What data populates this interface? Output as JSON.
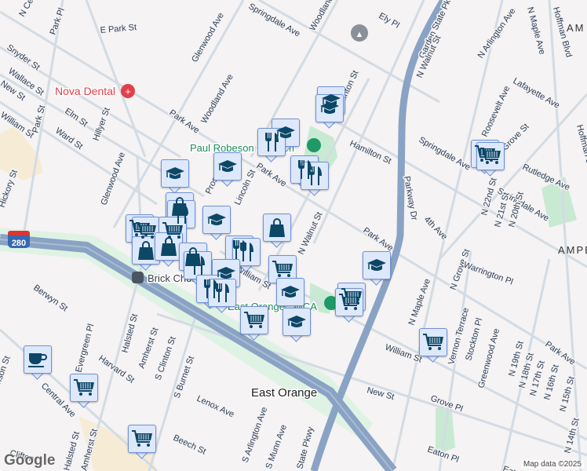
{
  "streets": [
    "N Cen",
    "Park Pl",
    "E Park St",
    "Glenwood Ave",
    "Springdale Ave",
    "Woodland Ave",
    "Ely Pl",
    "Garden State Pk",
    "N Walnut St",
    "N Arlington Ave",
    "N Maple Ave",
    "Hoffman Blvd",
    "Hoffman Blvd",
    "Snyder St",
    "Wallace St",
    "New St",
    "Elm St",
    "Ward St",
    "William St",
    "Park St",
    "Hillyer St",
    "Park Ave",
    "Woodland Ave",
    "Glenwood Ave",
    "Hickory St",
    "Lincoln St",
    "Prospect",
    "Park Ave",
    "N Clinton St",
    "Hamilton St",
    "Springdale Ave",
    "Roosevelt Ave",
    "Lafayette Ave",
    "N Grove St",
    "Rutledge Ave",
    "Springdale Ave",
    "Parkway Dr",
    "4th Ave",
    "N 22nd St",
    "N 21st St",
    "N 20th St",
    "Park Ave",
    "N Grove St",
    "Warrington Pl",
    "N Maple Ave",
    "Vernon Terrace",
    "Stockton Pl",
    "Greenwood Ave",
    "N 19th St",
    "N 18th St",
    "N 17th St",
    "N 16th St",
    "N 15th St",
    "N 14th St",
    "Park Ave",
    "William St",
    "New St",
    "Grove Pl",
    "Eaton Pl",
    "N Walnut St",
    "William St",
    "Berwyn St",
    "Evergreen Pl",
    "Halsted St",
    "Harvard St",
    "Amherst St",
    "S Clinton St",
    "S Burnet St",
    "Lenox Ave",
    "Beech St",
    "Central Ave",
    "S Arlington Ave",
    "S Munn Ave",
    "Halsted St",
    "Amherst St",
    "Clifton",
    "State Pkwy",
    "Eaton",
    "nson St"
  ],
  "places": {
    "nova_dental": "Nova Dental",
    "paul_robeson": "Paul Robeson Stadium",
    "ymca": "East Orange YMCA",
    "brick_church": "Brick Church",
    "east_orange": "East Orange",
    "ampere_top": "AM",
    "ampere": "AMPE"
  },
  "highway_shield": "280",
  "marker_types": [
    "school",
    "restaurant",
    "shopping-bag",
    "grocery-cart",
    "cafe"
  ],
  "colors": {
    "highway": "#8aa3c4",
    "park": "#c8ead2",
    "marker_bg": "#dde8fb",
    "marker_border": "#6f93d9",
    "icon": "#0d4766",
    "dental": "#e0404a"
  },
  "attribution": "Map data ©2025",
  "logo": "Google"
}
